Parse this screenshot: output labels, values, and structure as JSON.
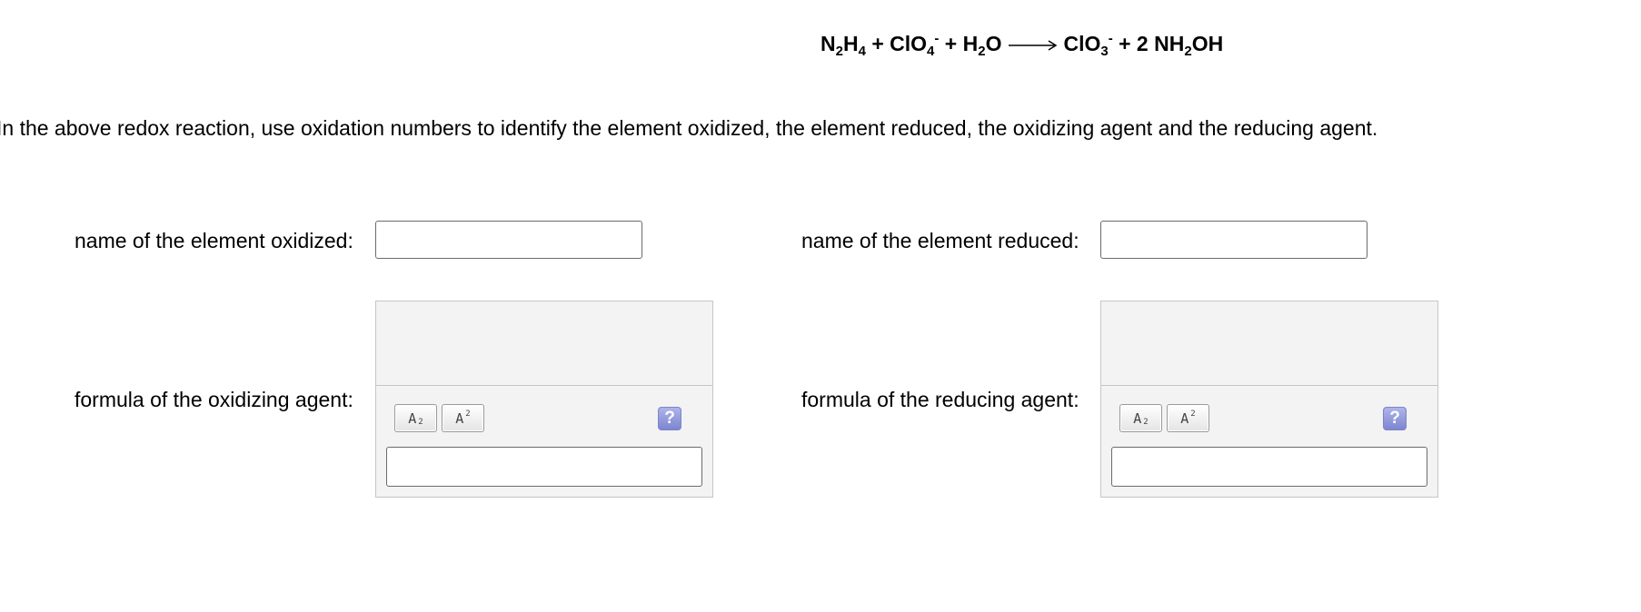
{
  "equation": {
    "n2h4_n": "N",
    "n2h4_sub1": "2",
    "n2h4_h": "H",
    "n2h4_sub2": "4",
    "plus1": "+",
    "clo4_base": "ClO",
    "clo4_sub": "4",
    "clo4_charge": "-",
    "plus2": "+",
    "h2o_h": "H",
    "h2o_sub": "2",
    "h2o_o": "O",
    "clo3_base": "ClO",
    "clo3_sub": "3",
    "clo3_charge": "-",
    "plus3": "+",
    "coef": "2",
    "nh2oh_nh": "NH",
    "nh2oh_sub": "2",
    "nh2oh_oh": "OH"
  },
  "instructions": "In the above redox reaction, use oxidation numbers to identify the element oxidized, the element reduced, the oxidizing agent and the reducing agent.",
  "fields": {
    "oxidized_label": "name of the element oxidized:",
    "oxidized_value": "",
    "reduced_label": "name of the element reduced:",
    "reduced_value": "",
    "oxidizing_label": "formula of the oxidizing agent:",
    "oxidizing_value": "",
    "reducing_label": "formula of the reducing agent:",
    "reducing_value": ""
  },
  "toolbar": {
    "subscript_letter": "A",
    "subscript_mark": "2",
    "superscript_letter": "A",
    "superscript_mark": "2",
    "help_label": "?"
  },
  "colors": {
    "help_button": "#7c85d0",
    "panel_background": "#f3f3f3"
  },
  "icons": {
    "subscript": "subscript-icon",
    "superscript": "superscript-icon",
    "help": "help-icon",
    "arrow": "reaction-arrow-icon"
  }
}
